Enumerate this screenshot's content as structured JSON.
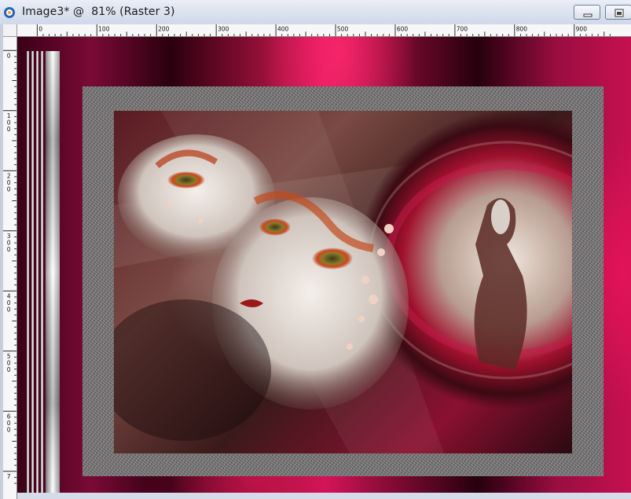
{
  "window": {
    "title": "Image3* @  81% (Raster 3)",
    "buttons": [
      "minimize-icon",
      "restore-icon"
    ]
  },
  "ruler_horizontal": {
    "labels": [
      "0",
      "100",
      "200",
      "300",
      "400",
      "500",
      "600",
      "700",
      "800",
      "900"
    ]
  },
  "ruler_vertical": {
    "labels": [
      "0",
      "100",
      "200",
      "300",
      "400",
      "500",
      "600",
      "7"
    ]
  },
  "colors": {
    "crimson": "#d4145a",
    "deep_maroon": "#3a0016",
    "frame_gray": "#6d6a6b"
  }
}
